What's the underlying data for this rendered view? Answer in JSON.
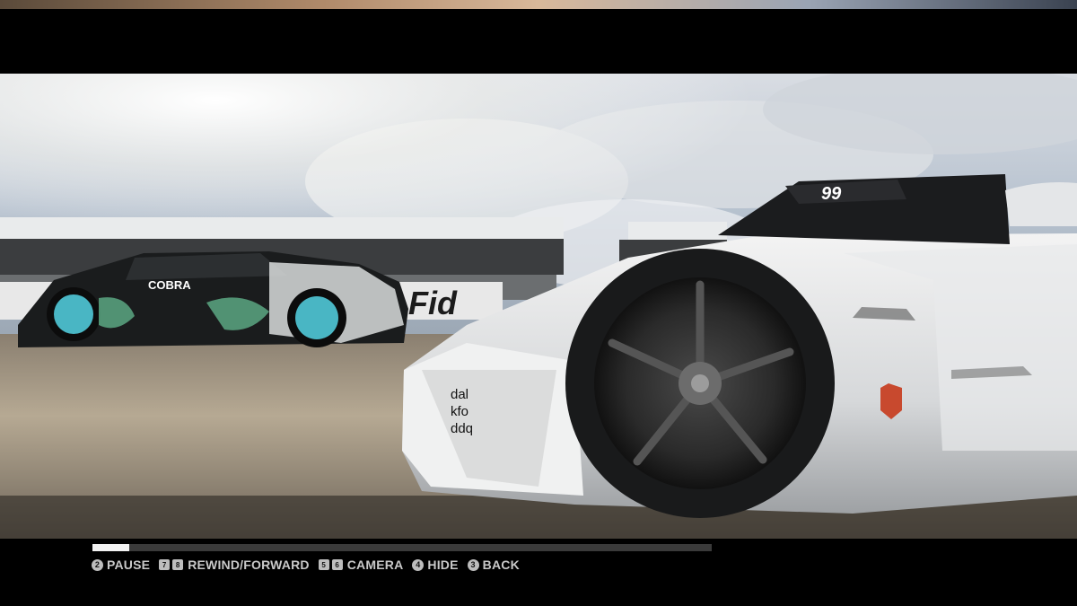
{
  "replay": {
    "progress_percent": 6,
    "car_number": "99",
    "rival_livery": "COBRA",
    "banner_text": "Fid",
    "sponsor_text": [
      "dal",
      "kfo",
      "ddq"
    ]
  },
  "controls": [
    {
      "key": "2",
      "key_shape": "circle",
      "label": "PAUSE"
    },
    {
      "keys": [
        "7",
        "8"
      ],
      "key_shape": "square",
      "label": "REWIND/FORWARD"
    },
    {
      "keys": [
        "5",
        "6"
      ],
      "key_shape": "square",
      "label": "CAMERA"
    },
    {
      "key": "4",
      "key_shape": "circle",
      "label": "HIDE"
    },
    {
      "key": "3",
      "key_shape": "circle",
      "label": "BACK"
    }
  ],
  "colors": {
    "hud_text": "#c9c9c9",
    "progress_fill": "#f2f2f2",
    "progress_track": "#3a3a3a",
    "letterbox": "#000000"
  }
}
